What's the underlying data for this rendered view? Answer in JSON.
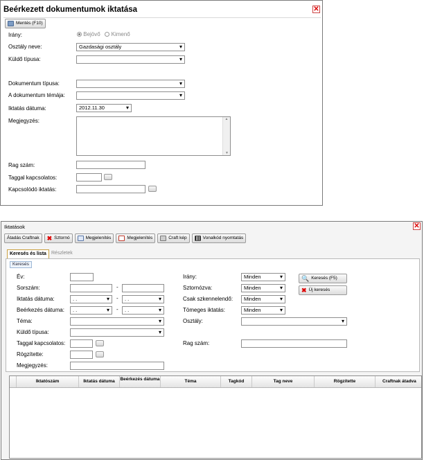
{
  "window1": {
    "title": "Beérkezett dokumentumok iktatása",
    "save_button": "Mentés (F10)",
    "labels": {
      "direction": "Irány:",
      "department": "Osztály neve:",
      "sender_type": "Küldő típusa:",
      "doc_type": "Dokumentum típusa:",
      "doc_subject": "A dokumentum témája:",
      "reg_date": "Iktatás dátuma:",
      "note": "Megjegyzés:",
      "rag_no": "Rag szám:",
      "tag_linked": "Taggal kapcsolatos:",
      "linked_reg": "Kapcsolódó iktatás:"
    },
    "direction_options": [
      "Bejövő",
      "Kimenő"
    ],
    "department_value": "Gazdasági osztály",
    "reg_date_value": "2012.11.30"
  },
  "window2": {
    "title": "Iktatások",
    "toolbar": [
      "Átadás Craftnak",
      "Sztornó",
      "Megjelenítés",
      "Megjelenítés",
      "Craft kép",
      "Vonalkód nyomtatás"
    ],
    "tabs": [
      "Keresés és lista",
      "Részletek"
    ],
    "group_title": "Keresés",
    "labels": {
      "year": "Év:",
      "serial": "Sorszám:",
      "reg_date": "Iktatás dátuma:",
      "recv_date": "Beérkezés dátuma:",
      "topic": "Téma:",
      "sender_type": "Küldő típusa:",
      "tag_linked": "Taggal kapcsolatos:",
      "recorded_by": "Rögzítette:",
      "note": "Megjegyzés:",
      "direction": "Irány:",
      "storno": "Sztornózva:",
      "scan_only": "Csak szkennelendő:",
      "bulk": "Tömeges iktatás:",
      "department": "Osztály:",
      "rag_no": "Rag szám:"
    },
    "dash": "-",
    "date_placeholder": ". .",
    "direction_value": "Minden",
    "storno_value": "Minden",
    "scan_value": "Minden",
    "bulk_value": "Minden",
    "search_button": "Keresés (F5)",
    "new_search_button": "Új keresés",
    "columns": [
      "Iktatószám",
      "Iktatás dátuma",
      "Beérkezés dátuma",
      "Téma",
      "Tagkód",
      "Tag neve",
      "Rögzítette",
      "Craftnak átadva"
    ]
  },
  "colors": {
    "close": "#cc0000",
    "tab_accent": "#f2c14e"
  }
}
